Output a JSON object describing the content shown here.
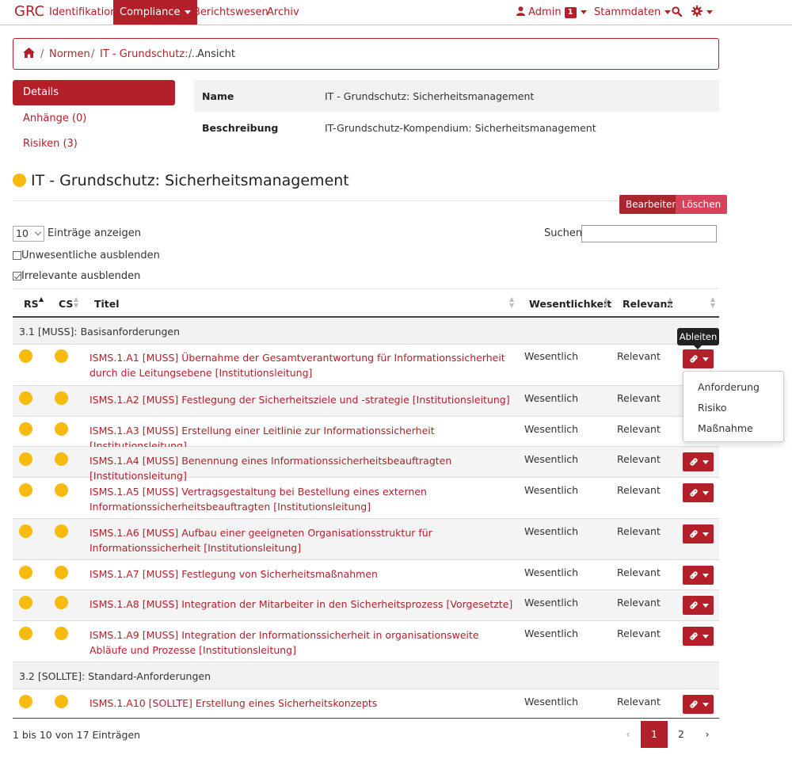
{
  "nav": {
    "brand": "GRC",
    "items": [
      "Identifikation",
      "Compliance",
      "Berichtswesen",
      "Archiv"
    ],
    "admin_label": "Admin",
    "admin_badge": "1",
    "stammdaten_label": "Stammdaten"
  },
  "breadcrumb": [
    "Normen",
    "IT - Grundschutz:...",
    "Ansicht"
  ],
  "sidebar": {
    "items": [
      "Details",
      "Anhänge (0)",
      "Risiken (3)"
    ]
  },
  "details": {
    "name_label": "Name",
    "name_value": "IT - Grundschutz: Sicherheitsmanagement",
    "desc_label": "Beschreibung",
    "desc_value": "IT-Grundschutz-Kompendium: Sicherheitsmanagement"
  },
  "page": {
    "title": "IT - Grundschutz: Sicherheitsmanagement",
    "edit_label": "Bearbeiten",
    "delete_label": "Löschen"
  },
  "controls": {
    "page_size": "10",
    "entries_label": "Einträge anzeigen",
    "search_label": "Suchen",
    "search_value": "",
    "hide_unessential": "Unwesentliche ausblenden",
    "hide_irrelevant": "Irrelevante ausblenden",
    "hide_unessential_checked": false,
    "hide_irrelevant_checked": true
  },
  "table": {
    "headers": [
      "RS",
      "CS",
      "Titel",
      "Wesentlichkeit",
      "Relevanz"
    ],
    "groups": [
      {
        "label": "3.1 [MUSS]: Basisanforderungen",
        "rows": [
          {
            "title": "ISMS.1.A1 [MUSS] Übernahme der Gesamtverantwortung für Informationssicherheit durch die Leitungsebene [Institutionsleitung]",
            "wesentlichkeit": "Wesentlich",
            "relevanz": "Relevant"
          },
          {
            "title": "ISMS.1.A2 [MUSS] Festlegung der Sicherheitsziele und -strategie [Institutionsleitung]",
            "wesentlichkeit": "Wesentlich",
            "relevanz": "Relevant"
          },
          {
            "title": "ISMS.1.A3 [MUSS] Erstellung einer Leitlinie zur Informationssicherheit [Institutionsleitung]",
            "wesentlichkeit": "Wesentlich",
            "relevanz": "Relevant"
          },
          {
            "title": "ISMS.1.A4 [MUSS] Benennung eines Informationssicherheitsbeauftragten [Institutionsleitung]",
            "wesentlichkeit": "Wesentlich",
            "relevanz": "Relevant"
          },
          {
            "title": "ISMS.1.A5 [MUSS] Vertragsgestaltung bei Bestellung eines externen Informationssicherheitsbeauftragten [Institutionsleitung]",
            "wesentlichkeit": "Wesentlich",
            "relevanz": "Relevant"
          },
          {
            "title": "ISMS.1.A6 [MUSS] Aufbau einer geeigneten Organisationsstruktur für Informationssicherheit [Institutionsleitung]",
            "wesentlichkeit": "Wesentlich",
            "relevanz": "Relevant"
          },
          {
            "title": "ISMS.1.A7 [MUSS] Festlegung von Sicherheitsmaßnahmen",
            "wesentlichkeit": "Wesentlich",
            "relevanz": "Relevant"
          },
          {
            "title": "ISMS.1.A8 [MUSS] Integration der Mitarbeiter in den Sicherheitsprozess [Vorgesetzte]",
            "wesentlichkeit": "Wesentlich",
            "relevanz": "Relevant"
          },
          {
            "title": "ISMS.1.A9 [MUSS] Integration der Informationssicherheit in organisationsweite Abläufe und Prozesse [Institutionsleitung]",
            "wesentlichkeit": "Wesentlich",
            "relevanz": "Relevant"
          }
        ]
      },
      {
        "label": "3.2 [SOLLTE]: Standard-Anforderungen",
        "rows": [
          {
            "title": "ISMS.1.A10 [SOLLTE] Erstellung eines Sicherheitskonzepts",
            "wesentlichkeit": "Wesentlich",
            "relevanz": "Relevant"
          }
        ]
      }
    ]
  },
  "tooltip": "Ableiten",
  "dropdown": [
    "Anforderung",
    "Risiko",
    "Maßnahme"
  ],
  "footer": {
    "info": "1 bis 10 von 17 Einträgen",
    "prev": "‹",
    "next": "›",
    "pages": [
      "1",
      "2"
    ]
  },
  "colors": {
    "primary": "#b3202a",
    "status_yellow": "#f7bb0f",
    "delete_button": "#d7435a"
  }
}
